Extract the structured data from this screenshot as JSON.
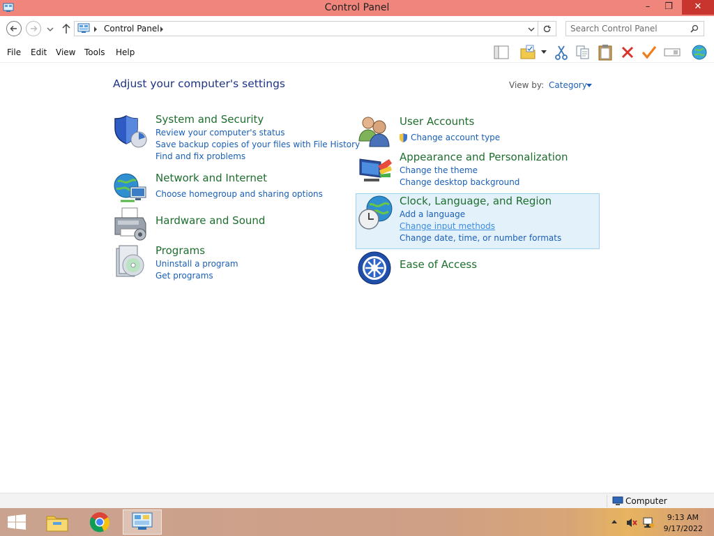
{
  "window": {
    "title": "Control Panel",
    "minimize_glyph": "–",
    "maximize_glyph": "❐",
    "close_glyph": "✕"
  },
  "address": {
    "breadcrumb": "Control Panel",
    "search_placeholder": "Search Control Panel"
  },
  "menu": [
    "File",
    "Edit",
    "View",
    "Tools",
    "Help"
  ],
  "toolbar_icons": [
    "layout-pane-icon",
    "folder-options-icon",
    "cut-icon",
    "copy-icon",
    "paste-icon",
    "delete-icon",
    "properties-check-icon",
    "rename-icon",
    "web-icon"
  ],
  "content": {
    "heading": "Adjust your computer's settings",
    "view_by_label": "View by:",
    "view_by_value": "Category"
  },
  "categories_left": [
    {
      "title": "System and Security",
      "icon": "shield-icon",
      "links": [
        "Review your computer's status",
        "Save backup copies of your files with File History",
        "Find and fix problems"
      ]
    },
    {
      "title": "Network and Internet",
      "icon": "network-globe-icon",
      "links": [
        "Choose homegroup and sharing options"
      ]
    },
    {
      "title": "Hardware and Sound",
      "icon": "printer-icon",
      "links": []
    },
    {
      "title": "Programs",
      "icon": "programs-disc-icon",
      "links": [
        "Uninstall a program",
        "Get programs"
      ]
    }
  ],
  "categories_right": [
    {
      "title": "User Accounts",
      "icon": "users-icon",
      "links": [
        "Change account type"
      ]
    },
    {
      "title": "Appearance and Personalization",
      "icon": "monitor-color-icon",
      "links": [
        "Change the theme",
        "Change desktop background"
      ]
    },
    {
      "title": "Clock, Language, and Region",
      "icon": "clock-globe-icon",
      "links": [
        "Add a language",
        "Change input methods",
        "Change date, time, or number formats"
      ]
    },
    {
      "title": "Ease of Access",
      "icon": "ease-of-access-icon",
      "links": []
    }
  ],
  "status": {
    "location": "Computer"
  },
  "taskbar": {
    "items": [
      "file-explorer-icon",
      "chrome-icon",
      "control-panel-icon"
    ],
    "time": "9:13 AM",
    "date": "9/17/2022"
  },
  "colors": {
    "titlebar": "#f0857c",
    "close": "#c7352e",
    "category_title": "#1e6e2e",
    "link": "#1a5fb8",
    "heading": "#1e3287",
    "highlight_bg": "#e3f1fb"
  }
}
